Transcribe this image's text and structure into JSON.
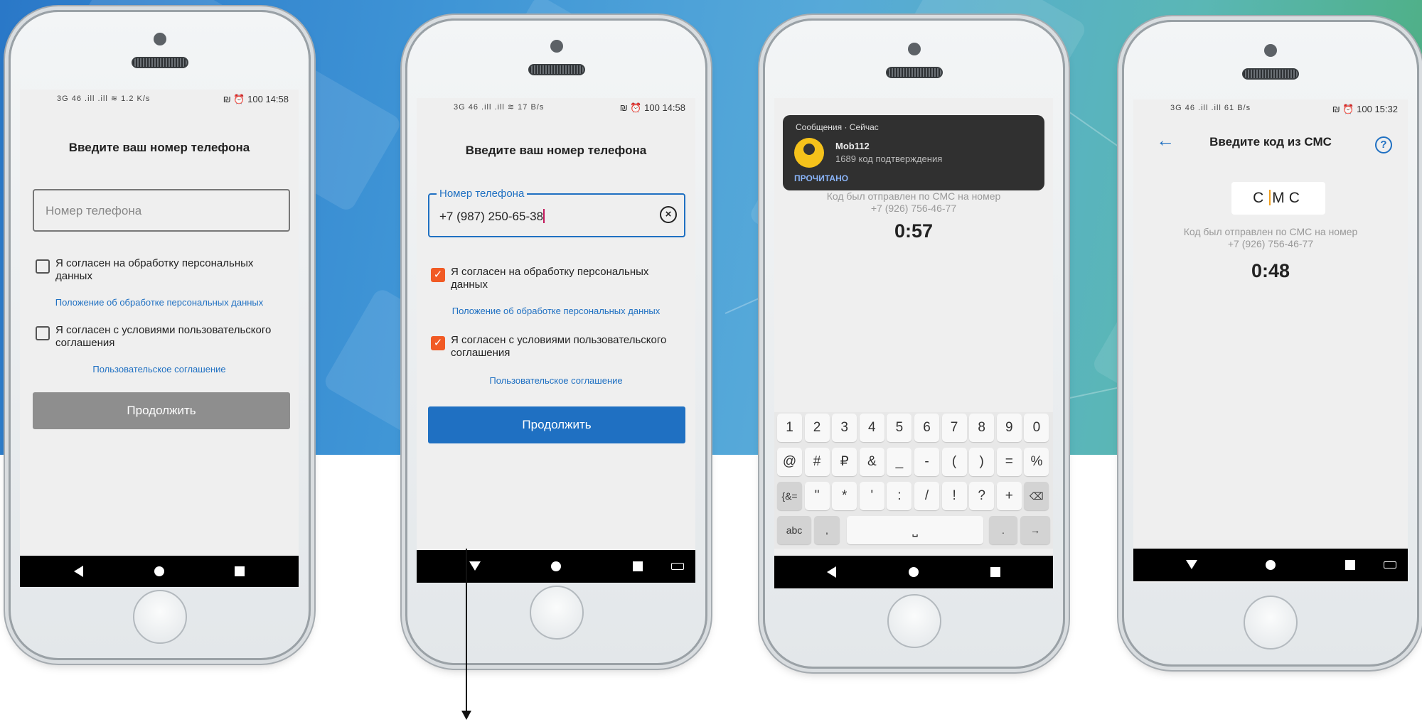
{
  "phones": [
    {
      "status": {
        "left": "3G 46 .ill .ill ≋ 1.2 K/s",
        "right": "₪ ⏰ 100 14:58"
      },
      "title": "Введите ваш номер телефона",
      "phone_field": {
        "placeholder": "Номер телефона"
      },
      "consent_personal": {
        "label": "Я согласен на обработку персональных данных",
        "checked": false
      },
      "personal_link": "Положение об обработке персональных данных",
      "consent_terms": {
        "label": "Я согласен с условиями пользовательского соглашения",
        "checked": false
      },
      "terms_link": "Пользовательское соглашение",
      "continue_button": {
        "label": "Продолжить",
        "state": "disabled"
      }
    },
    {
      "status": {
        "left": "3G 46 .ill .ill ≋ 17 B/s",
        "right": "₪ ⏰ 100 14:58"
      },
      "title": "Введите ваш номер телефона",
      "phone_field": {
        "label": "Номер телефона",
        "value": "+7 (987) 250-65-38"
      },
      "consent_personal": {
        "label": "Я согласен на обработку персональных данных",
        "checked": true
      },
      "personal_link": "Положение об обработке персональных данных",
      "consent_terms": {
        "label": "Я согласен с условиями пользовательского соглашения",
        "checked": true
      },
      "terms_link": "Пользовательское соглашение",
      "continue_button": {
        "label": "Продолжить",
        "state": "enabled"
      }
    },
    {
      "notification": {
        "app": "Сообщения · Сейчас",
        "sender": "Mob112",
        "message": "1689 код подтверждения",
        "action": "ПРОЧИТАНО"
      },
      "sms_info": {
        "line1": "Код был отправлен по СМС на номер",
        "line2": "+7 (926) 756-46-77"
      },
      "timer": "0:57",
      "keyboard": {
        "row1": [
          "1",
          "2",
          "3",
          "4",
          "5",
          "6",
          "7",
          "8",
          "9",
          "0"
        ],
        "row2": [
          "@",
          "#",
          "₽",
          "&",
          "_",
          "-",
          "(",
          ")",
          "=",
          "%"
        ],
        "row3": [
          "{&=",
          "\"",
          "*",
          "'",
          ":",
          "/",
          "!",
          "?",
          "+",
          "⌫"
        ],
        "abc": "abc",
        "comma": ",",
        "space": "⎵",
        "period": ".",
        "enter": "→"
      }
    },
    {
      "status": {
        "left": "3G 46 .ill .ill 61 B/s",
        "right": "₪ ⏰ 100 15:32"
      },
      "title": "Введите код из СМС",
      "code_input": {
        "chars": [
          "С",
          "М",
          "С"
        ]
      },
      "sms_info": {
        "line1": "Код был отправлен по СМС на номер",
        "line2": "+7 (926) 756-46-77"
      },
      "timer": "0:48"
    }
  ]
}
